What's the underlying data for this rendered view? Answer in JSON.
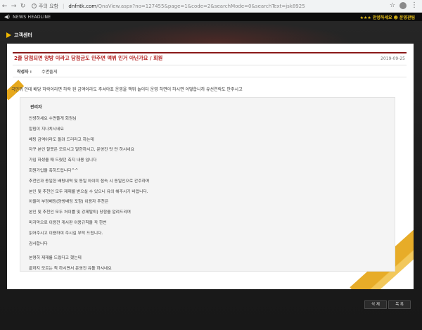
{
  "browser": {
    "security_label": "주의 요함",
    "url_domain": "dnfntk.com",
    "url_path": "/QnaView.aspx?no=127455&page=1&code=2&searchMode=0&searchText=jsk8925"
  },
  "news": {
    "title": "NEWS HEADLINE",
    "right_text": "★★★ 안녕하세요 ☻ 운영관팀"
  },
  "section": {
    "title": "고객센터"
  },
  "post": {
    "title": "2줄 당첨되면 양방 이라고 당첨금도 안주면 맥뷔 인거 아닌가요 / 회원",
    "date": "2019-09-25",
    "author_label": "작성자 :",
    "author_name": "수면뜰게"
  },
  "question": "국민뀌 인데 배당 하락이라면 하락 된 금액이라도 주셔야죠 운영을 맥뷔 놀이터 운영 하면이 하시면 어떻합니까 유선연락도 안주시고",
  "answer": {
    "admin_label": "관리자",
    "lines": [
      "안녕하세요 수면뜰게 회원님",
      "알림이 지나치시네요",
      "배팅 금액이라도 돌려 드리라고 하는데",
      "자꾸 본인 잘못은 모르시고 말한하시고, 운영진 탓 만 하시네요",
      "가입 하셨을 때 드렸던 축지 내용 입니다",
      "회원가입을 축하드립니다^^",
      "추천인과 동일한 배팅내역 및 동일 아이피 접속 시 동일인으로 간주하며",
      "본인 및 추천인 모두 제재를 받으실 수 있으니 유의 해주시기 바랍니다.",
      "아울러 부정배팅(양방배팅 포함) 이용자 추천은",
      "본인 및 추천인 모두 처이률 및 강제탈퇴) 당함을 알려드리며",
      "마지막으로 이용전 게시판 이용규칙을 꼭 한번",
      "읽어주시고 이용하여 주시길 부탁 드립니다.",
      "감사합니다"
    ],
    "closing_lines": [
      "본명히 제재를 드렸다고 했는데",
      "끝까지 모르는 척 하시면서 운영진 유틀 하시네요"
    ]
  },
  "buttons": {
    "delete": "삭 제",
    "list": "목 록"
  },
  "colors": {
    "accent": "#e6a81c",
    "title_red": "#b31f1f",
    "rule": "#8b1a1a"
  }
}
